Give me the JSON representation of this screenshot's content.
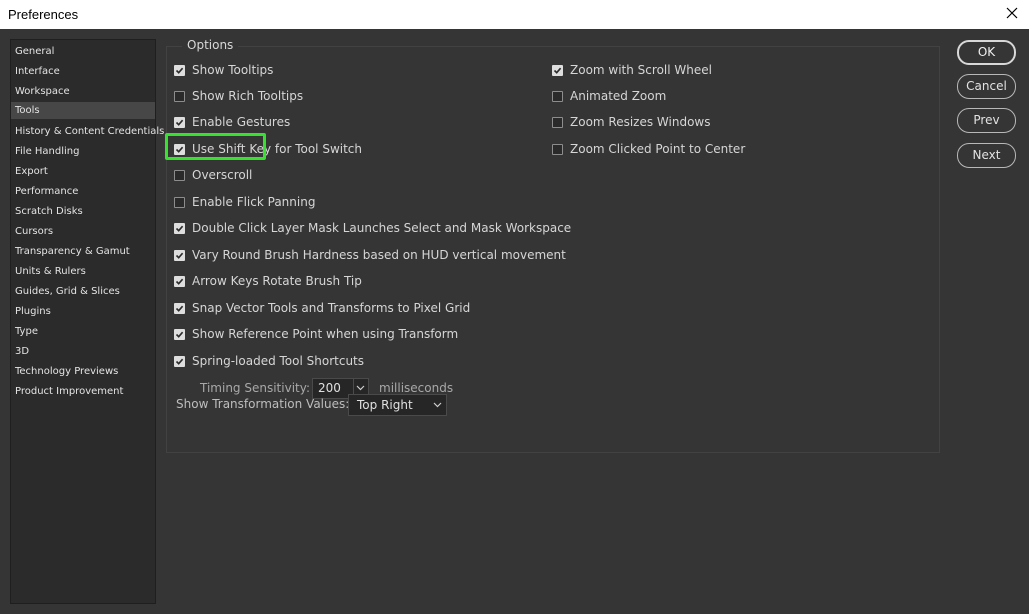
{
  "window": {
    "title": "Preferences"
  },
  "sidebar": {
    "items": [
      {
        "label": "General"
      },
      {
        "label": "Interface"
      },
      {
        "label": "Workspace"
      },
      {
        "label": "Tools",
        "selected": true
      },
      {
        "label": "History & Content Credentials"
      },
      {
        "label": "File Handling"
      },
      {
        "label": "Export"
      },
      {
        "label": "Performance"
      },
      {
        "label": "Scratch Disks"
      },
      {
        "label": "Cursors"
      },
      {
        "label": "Transparency & Gamut"
      },
      {
        "label": "Units & Rulers"
      },
      {
        "label": "Guides, Grid & Slices"
      },
      {
        "label": "Plugins"
      },
      {
        "label": "Type"
      },
      {
        "label": "3D"
      },
      {
        "label": "Technology Previews"
      },
      {
        "label": "Product Improvement"
      }
    ]
  },
  "options": {
    "legend": "Options",
    "left": [
      {
        "label": "Show Tooltips",
        "checked": true
      },
      {
        "label": "Show Rich Tooltips",
        "checked": false
      },
      {
        "label": "Enable Gestures",
        "checked": true
      },
      {
        "label": "Use Shift Key for Tool Switch",
        "checked": true
      },
      {
        "label": "Overscroll",
        "checked": false,
        "highlighted": true
      },
      {
        "label": "Enable Flick Panning",
        "checked": false
      },
      {
        "label": "Double Click Layer Mask Launches Select and Mask Workspace",
        "checked": true
      },
      {
        "label": "Vary Round Brush Hardness based on HUD vertical movement",
        "checked": true
      },
      {
        "label": "Arrow Keys Rotate Brush Tip",
        "checked": true
      },
      {
        "label": "Snap Vector Tools and Transforms to Pixel Grid",
        "checked": true
      },
      {
        "label": "Show Reference Point when using Transform",
        "checked": true
      },
      {
        "label": "Spring-loaded Tool Shortcuts",
        "checked": true
      }
    ],
    "right": [
      {
        "label": "Zoom with Scroll Wheel",
        "checked": true
      },
      {
        "label": "Animated Zoom",
        "checked": false
      },
      {
        "label": "Zoom Resizes Windows",
        "checked": false
      },
      {
        "label": "Zoom Clicked Point to Center",
        "checked": false
      }
    ],
    "timing": {
      "label": "Timing Sensitivity:",
      "value": "200",
      "unit": "milliseconds"
    },
    "transform": {
      "label": "Show Transformation Values:",
      "value": "Top Right"
    }
  },
  "buttons": {
    "ok": "OK",
    "cancel": "Cancel",
    "prev": "Prev",
    "next": "Next"
  },
  "colors": {
    "highlight": "#38e12f",
    "background": "#353535",
    "sidebar": "#2b2b2b"
  }
}
